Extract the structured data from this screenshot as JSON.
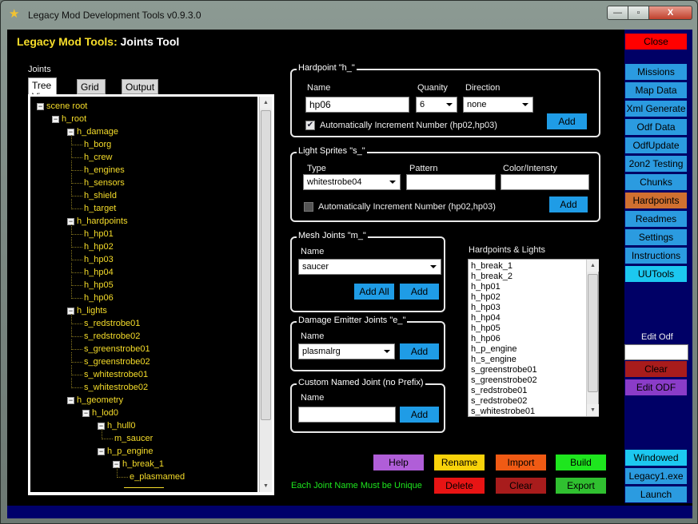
{
  "window": {
    "title": "Legacy Mod Development Tools v0.9.3.0",
    "min_glyph": "—",
    "max_glyph": "▫",
    "close_glyph": "X"
  },
  "header": {
    "prefix": "Legacy Mod Tools: ",
    "suffix": "Joints Tool"
  },
  "joints_panel": {
    "label": "Joints",
    "tabs": [
      "Tree View",
      "Grid View",
      "Output"
    ],
    "tree": [
      {
        "text": "scene root",
        "depth": 0,
        "expander": "−"
      },
      {
        "text": "h_root",
        "depth": 1,
        "expander": "−"
      },
      {
        "text": "h_damage",
        "depth": 2,
        "expander": "−"
      },
      {
        "text": "h_borg",
        "depth": 3
      },
      {
        "text": "h_crew",
        "depth": 3
      },
      {
        "text": "h_engines",
        "depth": 3
      },
      {
        "text": "h_sensors",
        "depth": 3
      },
      {
        "text": "h_shield",
        "depth": 3
      },
      {
        "text": "h_target",
        "depth": 3
      },
      {
        "text": "h_hardpoints",
        "depth": 2,
        "expander": "−"
      },
      {
        "text": "h_hp01",
        "depth": 3
      },
      {
        "text": "h_hp02",
        "depth": 3
      },
      {
        "text": "h_hp03",
        "depth": 3
      },
      {
        "text": "h_hp04",
        "depth": 3
      },
      {
        "text": "h_hp05",
        "depth": 3
      },
      {
        "text": "h_hp06",
        "depth": 3
      },
      {
        "text": "h_lights",
        "depth": 2,
        "expander": "−"
      },
      {
        "text": "s_redstrobe01",
        "depth": 3
      },
      {
        "text": "s_redstrobe02",
        "depth": 3
      },
      {
        "text": "s_greenstrobe01",
        "depth": 3
      },
      {
        "text": "s_greenstrobe02",
        "depth": 3
      },
      {
        "text": "s_whitestrobe01",
        "depth": 3
      },
      {
        "text": "s_whitestrobe02",
        "depth": 3
      },
      {
        "text": "h_geometry",
        "depth": 2,
        "expander": "−"
      },
      {
        "text": "h_lod0",
        "depth": 3,
        "expander": "−"
      },
      {
        "text": "h_hull0",
        "depth": 4,
        "expander": "−"
      },
      {
        "text": "m_saucer",
        "depth": 5
      },
      {
        "text": "h_p_engine",
        "depth": 4,
        "expander": "−"
      },
      {
        "text": "h_break_1",
        "depth": 5,
        "expander": "−"
      },
      {
        "text": "e_plasmamed",
        "depth": 6
      }
    ]
  },
  "hardpoint_box": {
    "title": "Hardpoint \"h_\"",
    "name_label": "Name",
    "name_value": "hp06",
    "quantity_label": "Quanity",
    "quantity_value": "6",
    "direction_label": "Direction",
    "direction_value": "none",
    "checkbox_checked": true,
    "checkbox_label": "Automatically Increment Number (hp02,hp03)",
    "add_label": "Add"
  },
  "light_box": {
    "title": "Light Sprites \"s_\"",
    "type_label": "Type",
    "type_value": "whitestrobe04",
    "pattern_label": "Pattern",
    "pattern_value": "",
    "color_label": "Color/Intensty",
    "color_value": "",
    "checkbox_checked": false,
    "checkbox_label": "Automatically Increment Number (hp02,hp03)",
    "add_label": "Add"
  },
  "mesh_box": {
    "title": "Mesh Joints \"m_\"",
    "name_label": "Name",
    "name_value": "saucer",
    "add_all_label": "Add All",
    "add_label": "Add"
  },
  "damage_box": {
    "title": "Damage Emitter Joints \"e_\"",
    "name_label": "Name",
    "name_value": "plasmalrg",
    "add_label": "Add"
  },
  "custom_box": {
    "title": "Custom Named Joint (no Prefix)",
    "name_label": "Name",
    "name_value": "",
    "add_label": "Add"
  },
  "hardpoints_lights": {
    "label": "Hardpoints & Lights",
    "items": [
      "h_break_1",
      "h_break_2",
      "h_hp01",
      "h_hp02",
      "h_hp03",
      "h_hp04",
      "h_hp05",
      "h_hp06",
      "h_p_engine",
      "h_s_engine",
      "s_greenstrobe01",
      "s_greenstrobe02",
      "s_redstrobe01",
      "s_redstrobe02",
      "s_whitestrobe01"
    ]
  },
  "bottom_buttons": {
    "help": "Help",
    "rename": "Rename",
    "import": "Import",
    "build": "Build",
    "delete": "Delete",
    "clear": "Clear",
    "export": "Export",
    "note": "Each Joint Name Must be Unique"
  },
  "right_panel": {
    "close": "Close",
    "missions": "Missions",
    "map_data": "Map Data",
    "xml_generate": "Xml Generate",
    "odf_data": "Odf Data",
    "odf_update": "OdfUpdate",
    "testing": "2on2 Testing",
    "chunks": "Chunks",
    "hardpoints": "Hardpoints",
    "readmes": "Readmes",
    "settings": "Settings",
    "instructions": "Instructions",
    "uutools": "UUTools",
    "edit_odf_label": "Edit Odf",
    "edit_odf_value": "",
    "clear": "Clear",
    "edit_odf_button": "Edit ODF",
    "windowed": "Windowed",
    "legacy_exe": "Legacy1.exe",
    "launch": "Launch"
  },
  "colors": {
    "accent_yellow": "#f6dd2a",
    "button_blue": "#1f9ce6",
    "panel_navy": "#000066",
    "close_red": "#ff0000",
    "hardpoints_orange": "#d07030"
  }
}
